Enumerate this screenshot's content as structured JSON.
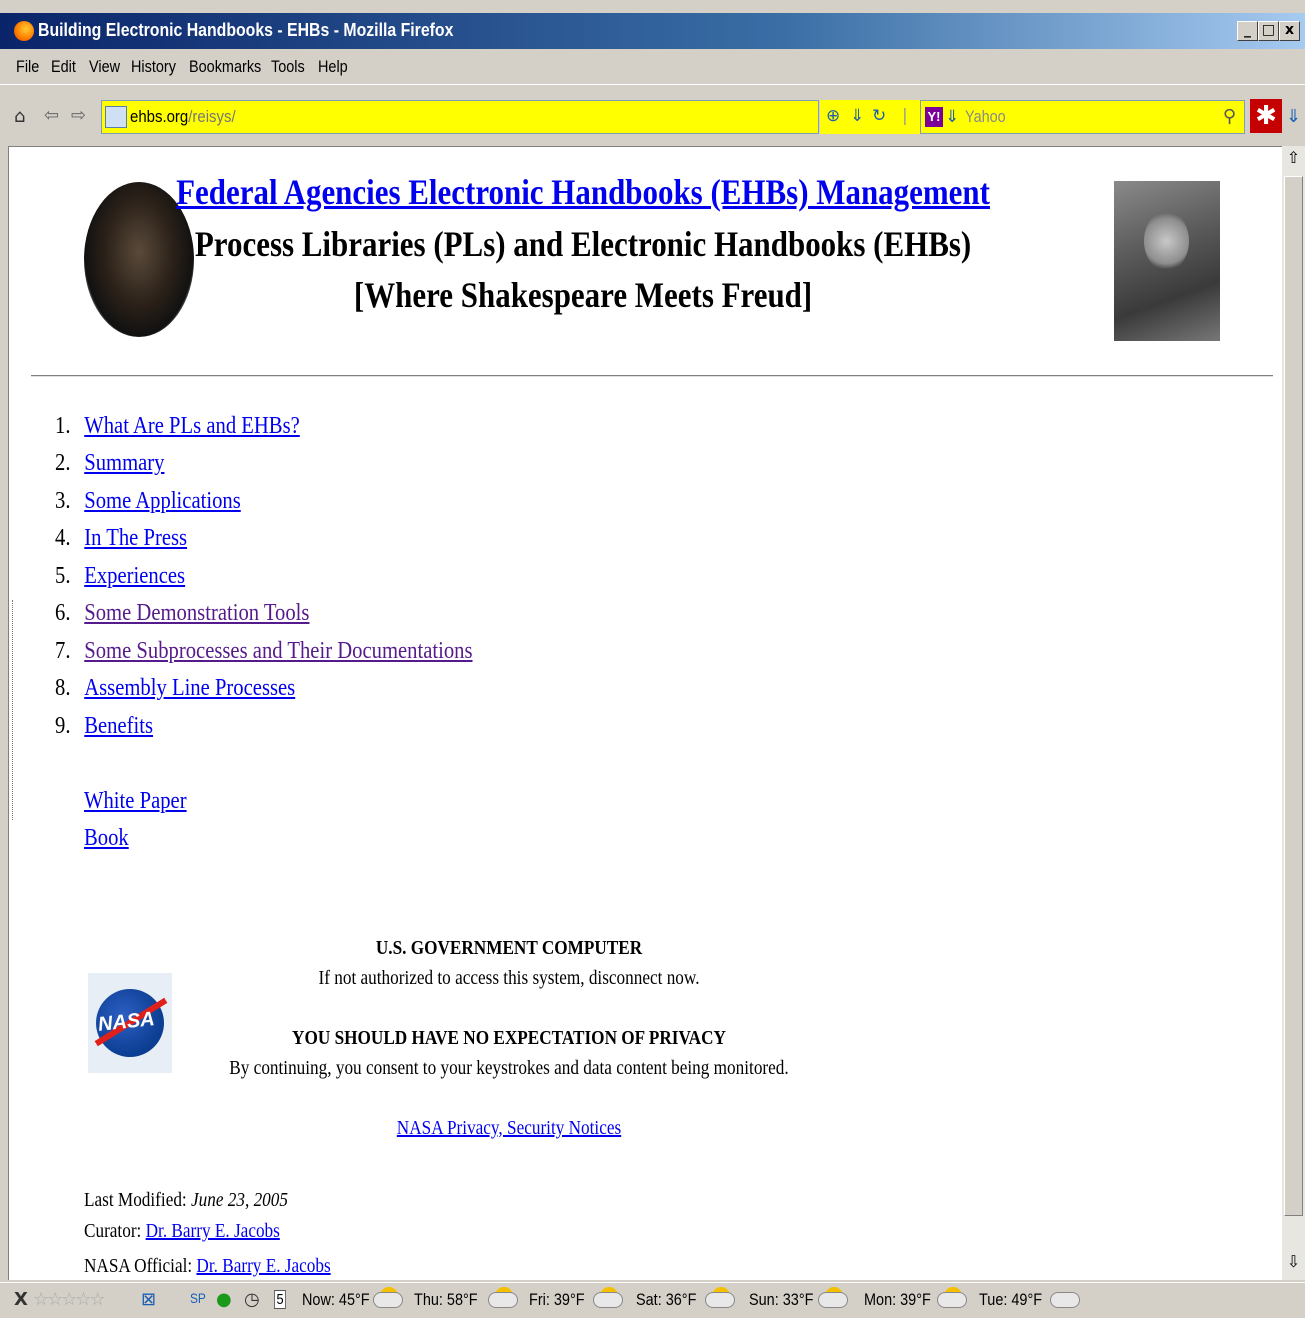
{
  "window": {
    "title": "Building Electronic Handbooks - EHBs - Mozilla Firefox",
    "controls": [
      "_",
      "□",
      "x"
    ]
  },
  "menu": [
    "File",
    "Edit",
    "View",
    "History",
    "Bookmarks",
    "Tools",
    "Help"
  ],
  "address": {
    "host": "ehbs.org",
    "path": "/reisys/"
  },
  "search": {
    "placeholder": "Yahoo"
  },
  "page": {
    "title_link": "Federal Agencies Electronic Handbooks (EHBs) Management",
    "subtitle": "Process Libraries (PLs) and Electronic Handbooks (EHBs)",
    "tagline": "[Where Shakespeare Meets Freud]",
    "toc": [
      {
        "num": "1.",
        "label": "What Are PLs and EHBs?"
      },
      {
        "num": "2.",
        "label": "Summary"
      },
      {
        "num": "3.",
        "label": "Some Applications"
      },
      {
        "num": "4.",
        "label": "In The Press"
      },
      {
        "num": "5.",
        "label": "Experiences"
      },
      {
        "num": "6.",
        "label": "Some Demonstration Tools"
      },
      {
        "num": "7.",
        "label": "Some Subprocesses and Their Documentations"
      },
      {
        "num": "8.",
        "label": "Assembly Line Processes"
      },
      {
        "num": "9.",
        "label": "Benefits"
      }
    ],
    "white_paper": "White Paper",
    "book": "Book",
    "gov_heading": "U.S. GOVERNMENT COMPUTER",
    "gov_line": "If not authorized to access this system, disconnect now.",
    "privacy_heading": "YOU SHOULD HAVE NO EXPECTATION OF PRIVACY",
    "privacy_line": "By continuing, you consent to your keystrokes and data content being monitored.",
    "nasa_link": "NASA Privacy, Security Notices",
    "nasa_logo_text": "NASA",
    "last_modified_label": "Last Modified:",
    "last_modified_date": "June 23, 2005",
    "curator_label": "Curator:",
    "curator_name": "Dr. Barry E. Jacobs",
    "official_label": "NASA Official:",
    "official_name": "Dr. Barry E. Jacobs"
  },
  "status": {
    "close": "X",
    "sp": "SP",
    "calendar_day": "5",
    "weather": [
      {
        "label": "Now: 45°F"
      },
      {
        "label": "Thu: 58°F"
      },
      {
        "label": "Fri: 39°F"
      },
      {
        "label": "Sat: 36°F"
      },
      {
        "label": "Sun: 33°F"
      },
      {
        "label": "Mon: 39°F"
      },
      {
        "label": "Tue: 49°F"
      }
    ]
  },
  "colors": {
    "link": "#0000ee",
    "visited": "#551a8b",
    "urlbar": "#ffff00"
  }
}
